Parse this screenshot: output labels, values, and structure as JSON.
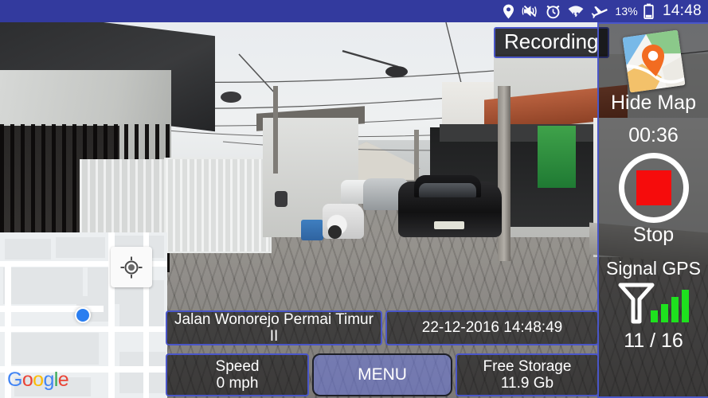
{
  "statusbar": {
    "icons": [
      "location-pin-icon",
      "vibrate-mute-icon",
      "alarm-clock-icon",
      "wifi-data-icon",
      "airplane-mode-icon"
    ],
    "battery_percent": "13%",
    "battery_icon": "battery-low-icon",
    "clock": "14:48",
    "background_color": "#333a9e"
  },
  "video": {
    "recording_badge": "Recording",
    "scene_description": "residential street dashcam view"
  },
  "map": {
    "provider_logo": "Google",
    "provider_logo_letters": [
      "G",
      "o",
      "o",
      "g",
      "l",
      "e"
    ],
    "my_location_icon": "my-location-icon",
    "position_dot_icon": "current-position-dot-icon",
    "dot_color": "#2a7ef0"
  },
  "right_panel": {
    "map_toggle_icon": "google-maps-icon",
    "hide_map_label": "Hide Map",
    "timer": "00:36",
    "stop_button_icon": "stop-square-icon",
    "stop_label": "Stop",
    "gps_label": "Signal GPS",
    "gps_signal_icon": "gps-antenna-bars-icon",
    "gps_bar_color": "#1ee11e",
    "gps_count": "11 / 16",
    "accent_color": "#4a56c8",
    "stop_color": "#f60c0c"
  },
  "bottom_bar": {
    "street_name": "Jalan Wonorejo Permai Timur II",
    "datetime": "22-12-2016  14:48:49",
    "speed_label": "Speed",
    "speed_value": "0 mph",
    "menu_label": "MENU",
    "storage_label": "Free Storage",
    "storage_value": "11.9 Gb"
  }
}
